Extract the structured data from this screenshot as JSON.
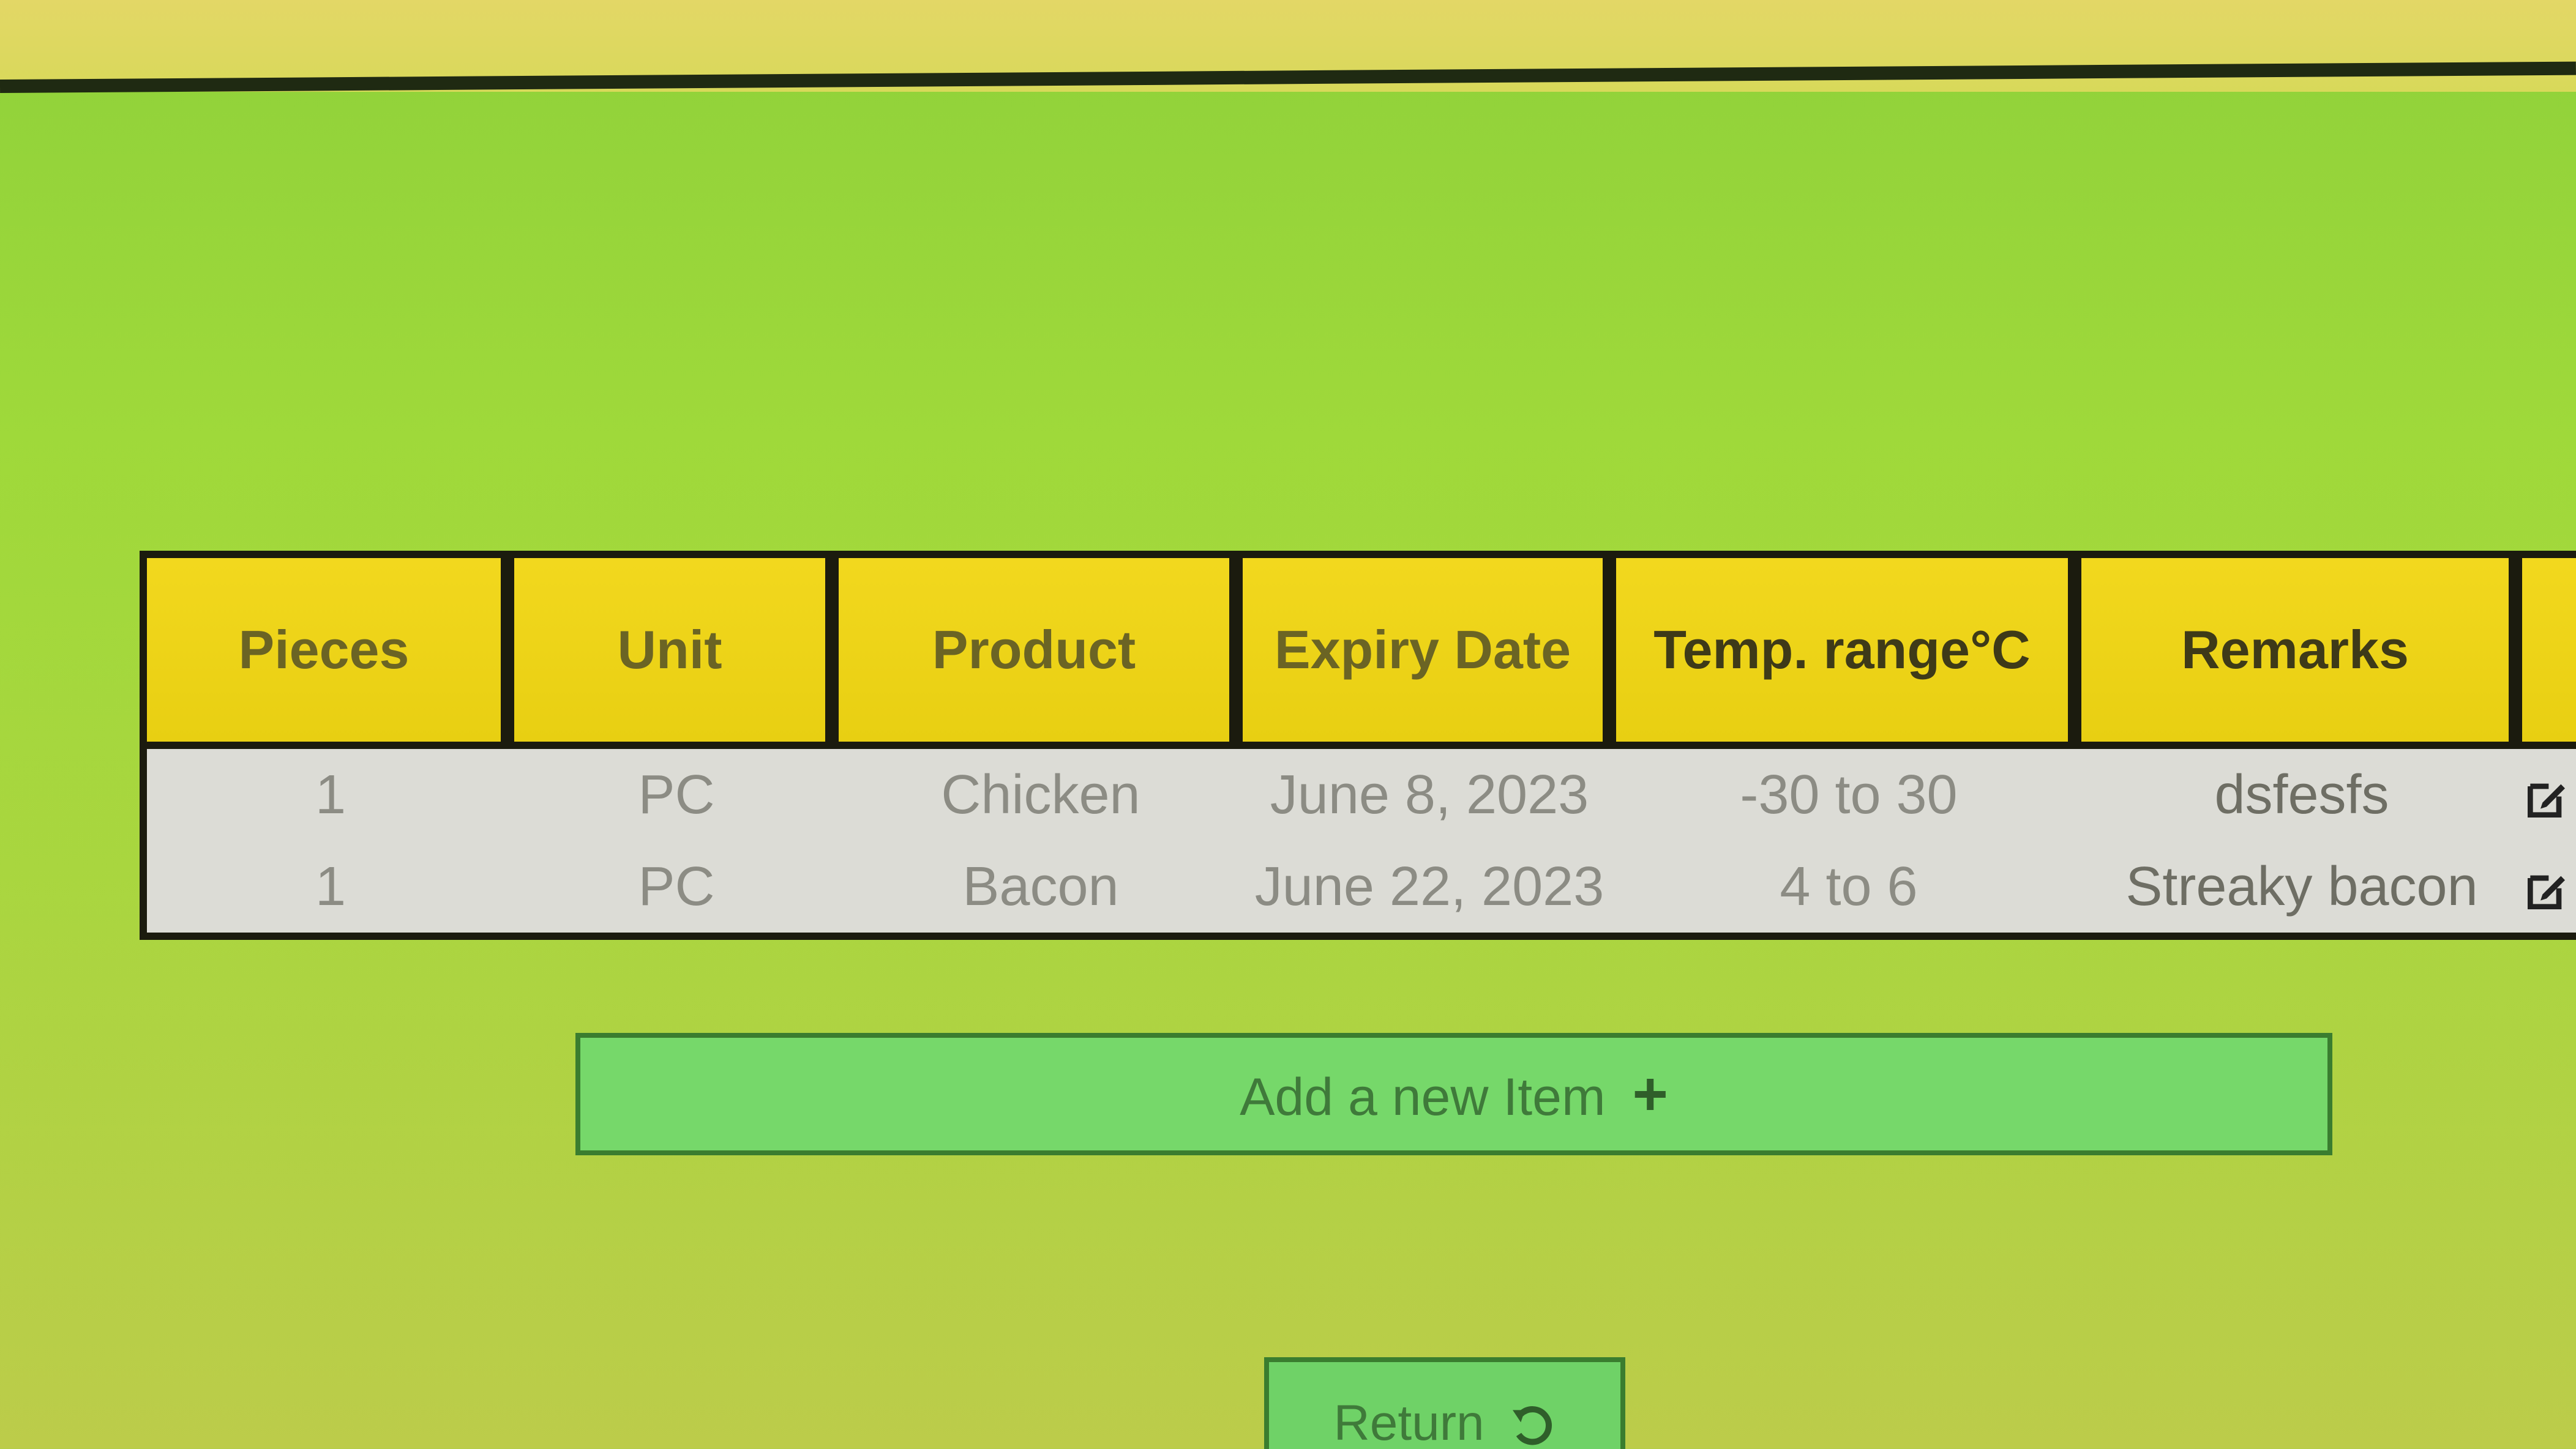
{
  "table": {
    "headers": [
      "Pieces",
      "Unit",
      "Product",
      "Expiry Date",
      "Temp. range°C",
      "Remarks",
      ""
    ],
    "rows": [
      {
        "pieces": "1",
        "unit": "PC",
        "product": "Chicken",
        "expiry": "June 8, 2023",
        "temp": "-30 to 30",
        "remarks": "dsfesfs",
        "edit_icon": "edit-icon"
      },
      {
        "pieces": "1",
        "unit": "PC",
        "product": "Bacon",
        "expiry": "June 22, 2023",
        "temp": "4 to 6",
        "remarks": "Streaky bacon",
        "edit_icon": "edit-icon"
      }
    ]
  },
  "actions": {
    "add_label": "Add a new Item",
    "add_icon": "plus-icon",
    "return_label": "Return",
    "return_icon": "undo-icon"
  },
  "colors": {
    "header_bg": "#f2d81e",
    "row_bg": "#dcdcd6",
    "button_bg": "#76d86a",
    "page_bg": "#9fd93a"
  }
}
